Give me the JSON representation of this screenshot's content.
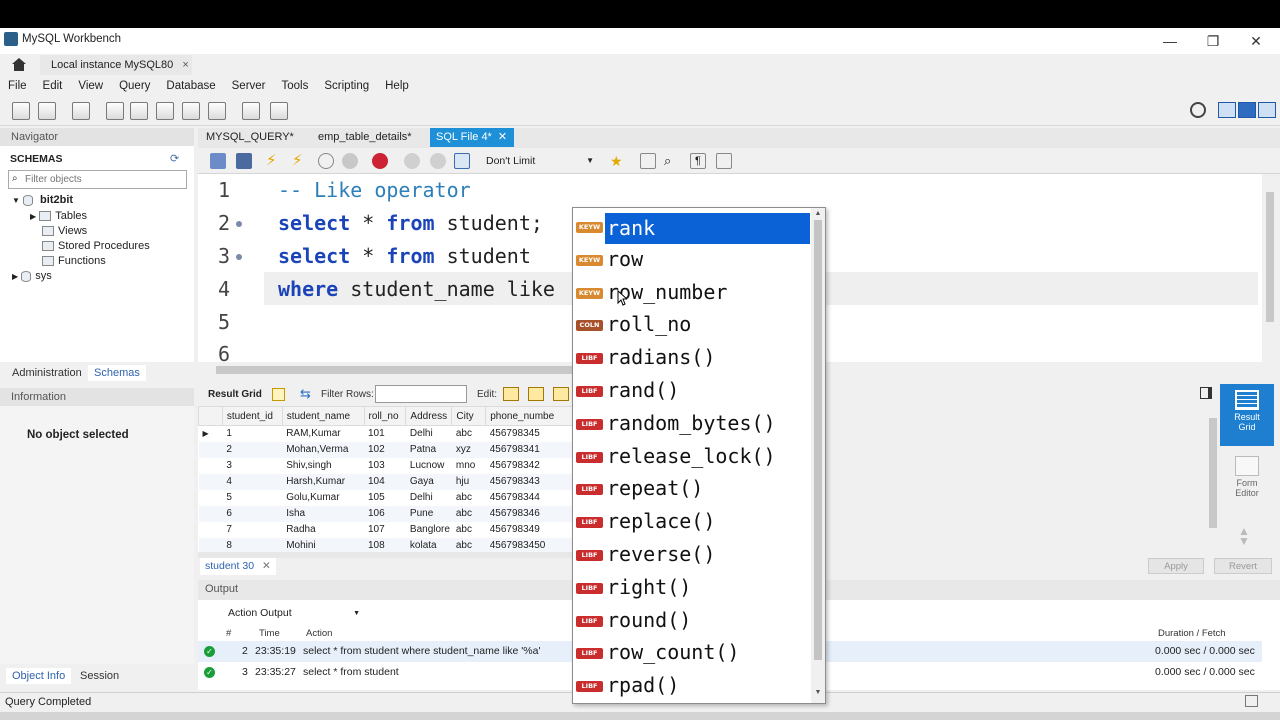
{
  "window": {
    "title": "MySQL Workbench",
    "minimize": "—",
    "maximize": "❐",
    "close": "✕"
  },
  "instance_tab": {
    "label": "Local instance MySQL80",
    "close": "×"
  },
  "menu": [
    "File",
    "Edit",
    "View",
    "Query",
    "Database",
    "Server",
    "Tools",
    "Scripting",
    "Help"
  ],
  "navigator": {
    "header": "Navigator",
    "schemas_title": "SCHEMAS",
    "filter_placeholder": "Filter objects",
    "schemas": [
      {
        "name": "bit2bit",
        "children": [
          "Tables",
          "Views",
          "Stored Procedures",
          "Functions"
        ]
      },
      {
        "name": "sys"
      }
    ],
    "bottom_tabs": [
      "Administration",
      "Schemas"
    ],
    "info_header": "Information",
    "info_text": "No object selected",
    "bottom_tabs2": [
      "Object Info",
      "Session"
    ]
  },
  "editor_tabs": [
    "MYSQL_QUERY*",
    "emp_table_details*",
    "SQL File 4*"
  ],
  "editor_toolbar": {
    "limit": "Don't Limit"
  },
  "code_lines": [
    {
      "num": "1",
      "comment": "-- Like operator"
    },
    {
      "num": "2",
      "k1": "select",
      "t1": " * ",
      "k2": "from",
      "t2": " student;"
    },
    {
      "num": "3",
      "k1": "select",
      "t1": " * ",
      "k2": "from",
      "t2": " student"
    },
    {
      "num": "4",
      "k1": "where",
      "t1": " student_name like"
    },
    {
      "num": "5"
    },
    {
      "num": "6"
    }
  ],
  "result": {
    "grid_label": "Result Grid",
    "filter_label": "Filter Rows:",
    "edit_label": "Edit:",
    "columns": [
      "student_id",
      "student_name",
      "roll_no",
      "Address",
      "City",
      "phone_numbe"
    ],
    "rows": [
      [
        "1",
        "RAM,Kumar",
        "101",
        "Delhi",
        "abc",
        "456798345"
      ],
      [
        "2",
        "Mohan,Verma",
        "102",
        "Patna",
        "xyz",
        "456798341"
      ],
      [
        "3",
        "Shiv,singh",
        "103",
        "Lucnow",
        "mno",
        "456798342"
      ],
      [
        "4",
        "Harsh,Kumar",
        "104",
        "Gaya",
        "hju",
        "456798343"
      ],
      [
        "5",
        "Golu,Kumar",
        "105",
        "Delhi",
        "abc",
        "456798344"
      ],
      [
        "6",
        "Isha",
        "106",
        "Pune",
        "abc",
        "456798346"
      ],
      [
        "7",
        "Radha",
        "107",
        "Banglore",
        "abc",
        "456798349"
      ],
      [
        "8",
        "Mohini",
        "108",
        "kolata",
        "abc",
        "4567983450"
      ]
    ],
    "result_tab": "student 30",
    "apply": "Apply",
    "revert": "Revert",
    "side_result": "Result Grid",
    "side_form": "Form Editor"
  },
  "autocomplete": [
    {
      "badge": "KEYW",
      "text": "rank",
      "selected": true
    },
    {
      "badge": "KEYW",
      "text": "row"
    },
    {
      "badge": "KEYW",
      "text": "row_number"
    },
    {
      "badge": "COLN",
      "text": "roll_no"
    },
    {
      "badge": "LIBF",
      "text": "radians()"
    },
    {
      "badge": "LIBF",
      "text": "rand()"
    },
    {
      "badge": "LIBF",
      "text": "random_bytes()"
    },
    {
      "badge": "LIBF",
      "text": "release_lock()"
    },
    {
      "badge": "LIBF",
      "text": "repeat()"
    },
    {
      "badge": "LIBF",
      "text": "replace()"
    },
    {
      "badge": "LIBF",
      "text": "reverse()"
    },
    {
      "badge": "LIBF",
      "text": "right()"
    },
    {
      "badge": "LIBF",
      "text": "round()"
    },
    {
      "badge": "LIBF",
      "text": "row_count()"
    },
    {
      "badge": "LIBF",
      "text": "rpad()"
    }
  ],
  "badge_colors": {
    "KEYW": "#d9892f",
    "COLN": "#a8502a",
    "LIBF": "#c92d2d"
  },
  "output": {
    "header": "Output",
    "mode": "Action Output",
    "cols": {
      "num": "#",
      "time": "Time",
      "action": "Action",
      "duration": "Duration / Fetch"
    },
    "rows": [
      {
        "n": "2",
        "time": "23:35:19",
        "action": "select * from student  where student_name like '%a'",
        "dur": "0.000 sec / 0.000 sec"
      },
      {
        "n": "3",
        "time": "23:35:27",
        "action": "select * from student",
        "dur": "0.000 sec / 0.000 sec"
      }
    ]
  },
  "status": "Query Completed"
}
